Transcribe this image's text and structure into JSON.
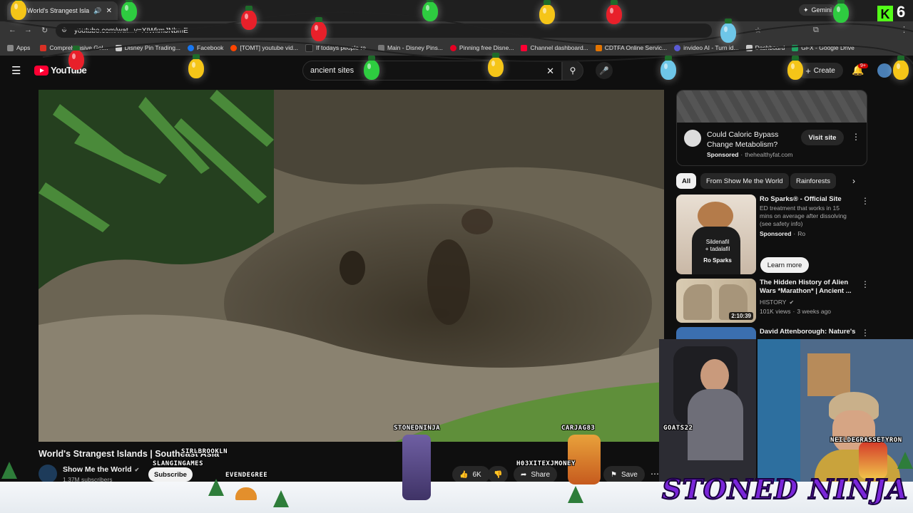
{
  "browser": {
    "tab_title": "World's Strangest Islan",
    "tab_gemini": "Gemini",
    "url": "youtube.com/wat...v=XIWkmJNbmE",
    "bookmarks": [
      {
        "label": "Apps",
        "color": "#888888"
      },
      {
        "label": "Comprehensive Gol...",
        "color": "#d93025"
      },
      {
        "label": "Disney Pin Trading...",
        "color": "#cccccc"
      },
      {
        "label": "Facebook",
        "color": "#1877f2"
      },
      {
        "label": "[TOMT] youtube vid...",
        "color": "#ff4500"
      },
      {
        "label": "If todays people re...",
        "color": "#222222"
      },
      {
        "label": "Main - Disney Pins...",
        "color": "#777777"
      },
      {
        "label": "Pinning free Disne...",
        "color": "#e60023"
      },
      {
        "label": "Channel dashboard...",
        "color": "#ff0033"
      },
      {
        "label": "CDTFA Online Servic...",
        "color": "#e37400"
      },
      {
        "label": "invideo AI - Turn id...",
        "color": "#5b5bd6"
      },
      {
        "label": "Dashboard",
        "color": "#cccccc"
      },
      {
        "label": "GFX - Google Drive",
        "color": "#1fa463"
      }
    ]
  },
  "youtube": {
    "logo_text": "YouTube",
    "search_value": "ancient sites",
    "create_label": "Create",
    "notif_badge": "9+",
    "colors": {
      "brand_red": "#ff0033"
    }
  },
  "video": {
    "title": "World's Strangest Islands | Southeast Asia",
    "channel": "Show Me the World",
    "subscribers": "1.37M subscribers",
    "subscribe_label": "Subscribe",
    "likes": "6K",
    "share_label": "Share",
    "save_label": "Save"
  },
  "sidebar": {
    "ad": {
      "title": "Could Caloric Bypass Change Metabolism?",
      "sponsored": "Sponsored",
      "domain": "thehealthyfat.com",
      "button": "Visit site"
    },
    "chips": [
      "All",
      "From Show Me the World",
      "Rainforests"
    ],
    "items": [
      {
        "title": "Ro Sparks® - Official Site",
        "desc": "ED treatment that works in 15 mins on average after dissolving (see safety info)",
        "sponsored": "Sponsored",
        "channel": "Ro",
        "button": "Learn more",
        "thumb_text_1": "Sildenafil",
        "thumb_text_2": "+ tadalafil",
        "thumb_text_3": "Ro Sparks"
      },
      {
        "title": "The Hidden History of Alien Wars *Marathon* | Ancient ...",
        "channel": "HISTORY",
        "views": "101K views",
        "age": "3 weeks ago",
        "duration": "2:10:39"
      },
      {
        "title": "David Attenborough: Nature's"
      }
    ]
  },
  "overlay": {
    "brand": "STONED NINJA",
    "usernames": [
      "STONEDNINJA",
      "CARJAG83",
      "GOATS22",
      "NEILDEGRASSETYRON",
      "SIRLBROOKLN",
      "SLANGINGAMES",
      "EVENDEGREE",
      "H03XITEXJMONEY"
    ],
    "kick_counter": "6"
  }
}
